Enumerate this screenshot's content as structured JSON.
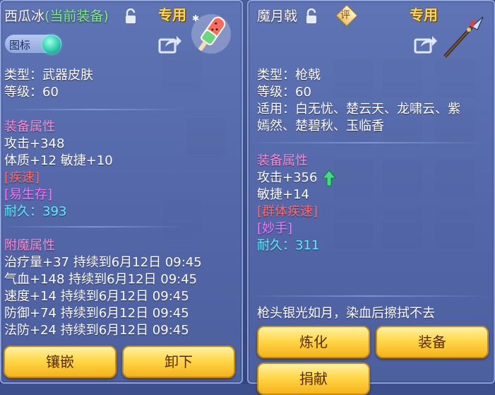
{
  "left_panel": {
    "title_name": "西瓜冰",
    "title_status": "(当前装备)",
    "exclusive_label": "专用",
    "toggle_label": "图标",
    "lines": {
      "type": "类型：武器皮肤",
      "level": "等级：60",
      "equip_attr_header": "装备属性",
      "attack": "攻击+348",
      "phys_agi": "体质+12 敏捷+10",
      "skill1": "[疾速]",
      "skill2": "[易生存]",
      "durability_label": "耐久：",
      "durability_value": "393",
      "enchant_header": "附魔属性",
      "enchant1": "治疗量+37 持续到6月12日 09:45",
      "enchant2": "气血+148 持续到6月12日 09:45",
      "enchant3": "速度+14 持续到6月12日 09:45",
      "enchant4": "防御+74 持续到6月12日 09:45",
      "enchant5": "法防+24 持续到6月12日 09:45"
    },
    "buttons": {
      "inlay": "镶嵌",
      "unequip": "卸下"
    }
  },
  "right_panel": {
    "title_name": "魔月戟",
    "review_badge": "评",
    "exclusive_label": "专用",
    "lines": {
      "type": "类型：枪戟",
      "level": "等级：60",
      "usable1": "适用：白无忧、楚云天、龙啸云、紫",
      "usable2": "嫣然、楚碧秋、玉临香",
      "equip_attr_header": "装备属性",
      "attack": "攻击+356",
      "agility": "敏捷+14",
      "skill1": "[群体疾速]",
      "skill2": "[妙手]",
      "durability_label": "耐久：",
      "durability_value": "311",
      "flavor": "枪头银光如月，染血后擦拭不去"
    },
    "buttons": {
      "refine": "炼化",
      "equip": "装备",
      "donate": "捐献"
    }
  },
  "colors": {
    "section_header": "#ff8bd4",
    "skill_red": "#ff6b6b",
    "skill_magenta": "#ff74ff",
    "durability": "#5cf0ff",
    "exclusive": "#ffd84a",
    "current_equip": "#7cf37c",
    "button": "#ffd84a"
  },
  "icons": [
    "lock-icon",
    "share-icon",
    "popsicle-skin-icon",
    "halberd-icon",
    "review-badge-icon",
    "up-arrow-icon"
  ]
}
